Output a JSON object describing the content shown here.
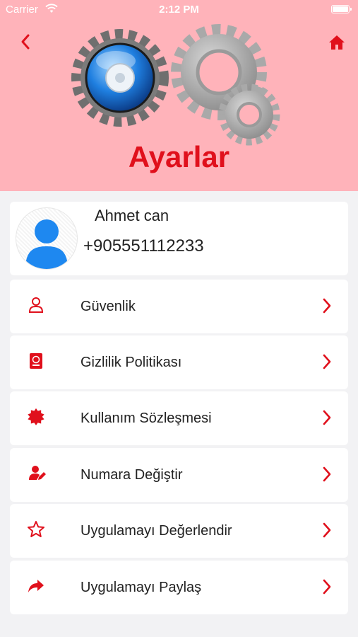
{
  "status_bar": {
    "carrier": "Carrier",
    "time": "2:12 PM"
  },
  "header": {
    "title": "Ayarlar",
    "background_color": "#ffb3ba",
    "accent_color": "#e0101c",
    "back_icon": "chevron-left-icon",
    "home_icon": "home-icon",
    "illustration": "gears-illustration"
  },
  "profile": {
    "name": "Ahmet can",
    "phone": "+905551112233",
    "avatar_icon": "user-avatar-icon"
  },
  "menu": [
    {
      "label": "Güvenlik",
      "icon": "user-outline-icon"
    },
    {
      "label": "Gizlilik Politikası",
      "icon": "passport-icon"
    },
    {
      "label": "Kullanım Sözleşmesi",
      "icon": "certificate-badge-icon"
    },
    {
      "label": "Numara Değiştir",
      "icon": "user-edit-icon"
    },
    {
      "label": "Uygulamayı Değerlendir",
      "icon": "star-outline-icon"
    },
    {
      "label": "Uygulamayı Paylaş",
      "icon": "share-arrow-icon"
    }
  ]
}
